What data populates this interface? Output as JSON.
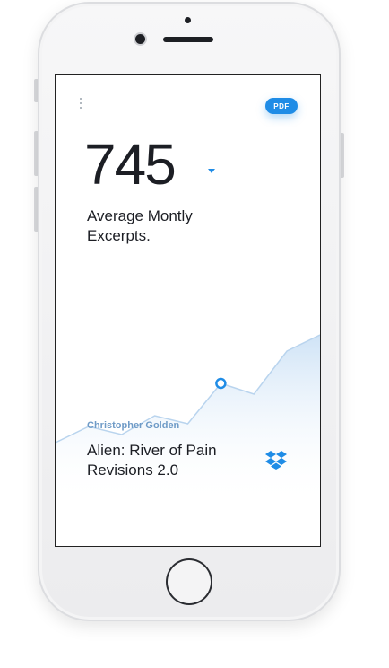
{
  "stat": {
    "value": "745",
    "label": "Average Montly Excerpts."
  },
  "toolbar": {
    "pdf_label": "PDF",
    "menu_icon": "more-vertical-icon"
  },
  "book": {
    "author": "Christopher Golden",
    "title": "Alien: River of Pain Revisions 2.0",
    "cloud_icon": "dropbox-icon"
  },
  "colors": {
    "accent": "#1f8ce6",
    "author_text": "#6f9bc7",
    "chart_line": "#b9d4ee"
  },
  "chart_data": {
    "type": "area",
    "x": [
      0,
      1,
      2,
      3,
      4,
      5,
      6,
      7,
      8
    ],
    "values": [
      10,
      16,
      13,
      20,
      17,
      32,
      28,
      44,
      50
    ],
    "highlight_index": 5,
    "title": "",
    "xlabel": "",
    "ylabel": "",
    "ylim": [
      0,
      60
    ],
    "grid": false
  }
}
